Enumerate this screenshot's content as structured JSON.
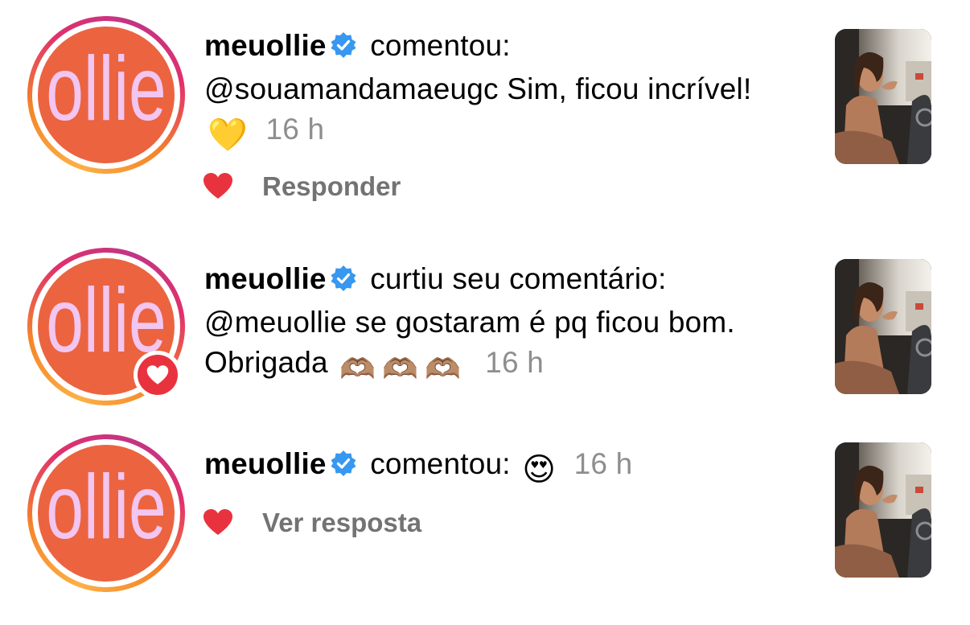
{
  "notifications": [
    {
      "username": "meuollie",
      "action": "comentou:",
      "text": "@souamandamaeugc Sim, ficou incrível!",
      "emoji": "💛",
      "time": "16 h",
      "reply_label": "Responder",
      "avatar_text": "ollie"
    },
    {
      "username": "meuollie",
      "action": "curtiu seu comentário:",
      "text": "@meuollie se gostaram é pq ficou bom. Obrigada",
      "emoji": "🫶🏽🫶🏽🫶🏽",
      "time": "16 h",
      "avatar_text": "ollie"
    },
    {
      "username": "meuollie",
      "action": "comentou:",
      "emoji": "😍",
      "time": "16 h",
      "reply_label": "Ver resposta",
      "avatar_text": "ollie"
    }
  ],
  "colors": {
    "avatar_bg": "#ec6340",
    "avatar_text": "#f2c6f0",
    "verified": "#3897f0",
    "like_red": "#e8333f",
    "muted_text": "#737373",
    "time_text": "#8e8e8e"
  },
  "icons": {
    "verified": "verified-badge-icon",
    "like": "heart-icon",
    "liked_badge": "heart-badge-icon"
  }
}
